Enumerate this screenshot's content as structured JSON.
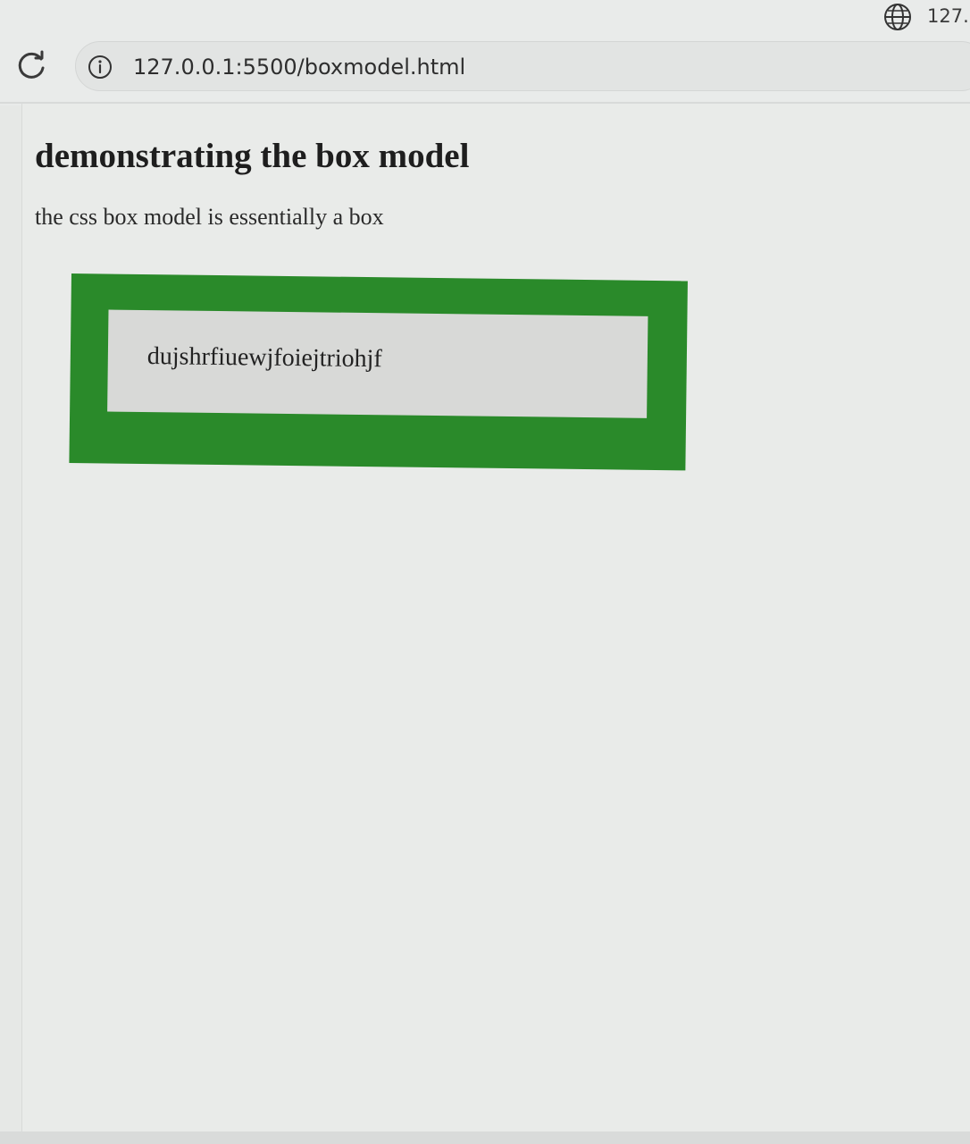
{
  "browser": {
    "tab_title": "127.0.0.1:5500/boxmodel.html",
    "tab_icon": "globe-icon",
    "reload_icon": "reload-icon",
    "site_info_icon": "info-icon",
    "url": "127.0.0.1:5500/boxmodel.html"
  },
  "page": {
    "heading": "demonstrating the box model",
    "paragraph": "the css box model is essentially a box",
    "box_content": "dujshrfiuewjfoiejtriohjf",
    "box_border_color": "#2a8a2a",
    "box_background_color": "#d8d9d7"
  }
}
